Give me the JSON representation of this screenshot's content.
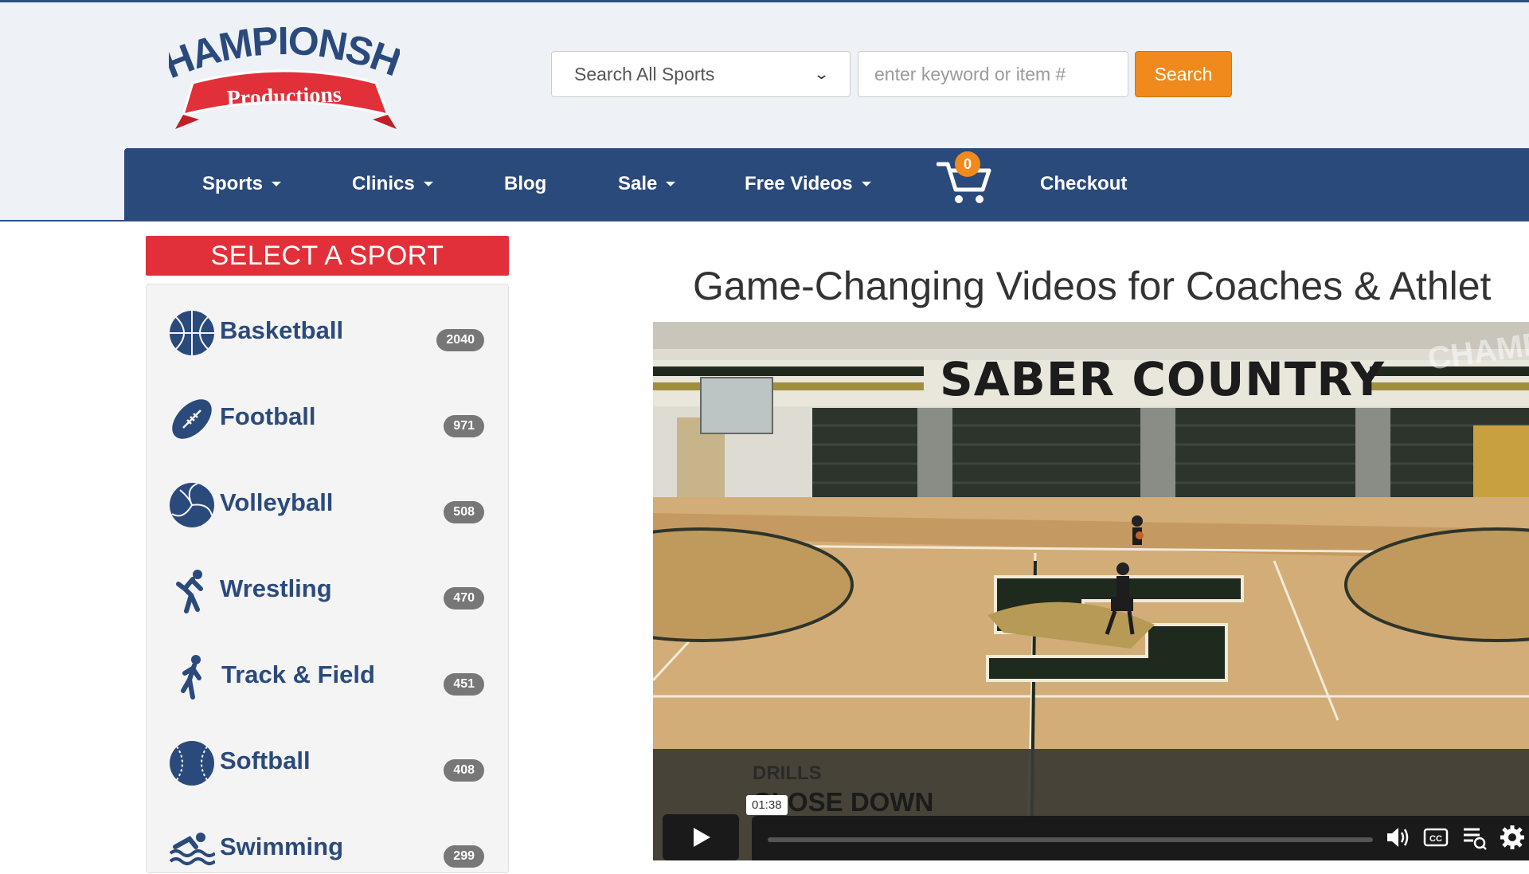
{
  "search": {
    "category_selected": "Search All Sports",
    "placeholder": "enter keyword or item #",
    "button_label": "Search"
  },
  "nav": {
    "items": [
      {
        "label": "Sports",
        "dropdown": true
      },
      {
        "label": "Clinics",
        "dropdown": true
      },
      {
        "label": "Blog",
        "dropdown": false
      },
      {
        "label": "Sale",
        "dropdown": true
      },
      {
        "label": "Free Videos",
        "dropdown": true
      }
    ],
    "cart_count": "0",
    "checkout_label": "Checkout"
  },
  "sidebar": {
    "header": "SELECT A SPORT",
    "sports": [
      {
        "name": "Basketball",
        "count": "2040",
        "icon": "basketball-icon"
      },
      {
        "name": "Football",
        "count": "971",
        "icon": "football-icon"
      },
      {
        "name": "Volleyball",
        "count": "508",
        "icon": "volleyball-icon"
      },
      {
        "name": "Wrestling",
        "count": "470",
        "icon": "wrestling-icon"
      },
      {
        "name": "Track & Field",
        "count": "451",
        "icon": "runner-icon"
      },
      {
        "name": "Softball",
        "count": "408",
        "icon": "softball-icon"
      },
      {
        "name": "Swimming",
        "count": "299",
        "icon": "swimmer-icon"
      }
    ]
  },
  "main": {
    "title": "Game-Changing Videos for Coaches & Athlet",
    "video": {
      "banner_text": "SABER COUNTRY",
      "caption_category": "DRILLS",
      "caption_title": "CLOSE DOWN",
      "timestamp_tooltip": "01:38"
    }
  },
  "colors": {
    "brand_blue": "#2b4a7c",
    "accent_orange": "#f08a1c",
    "header_red": "#e2303a"
  }
}
